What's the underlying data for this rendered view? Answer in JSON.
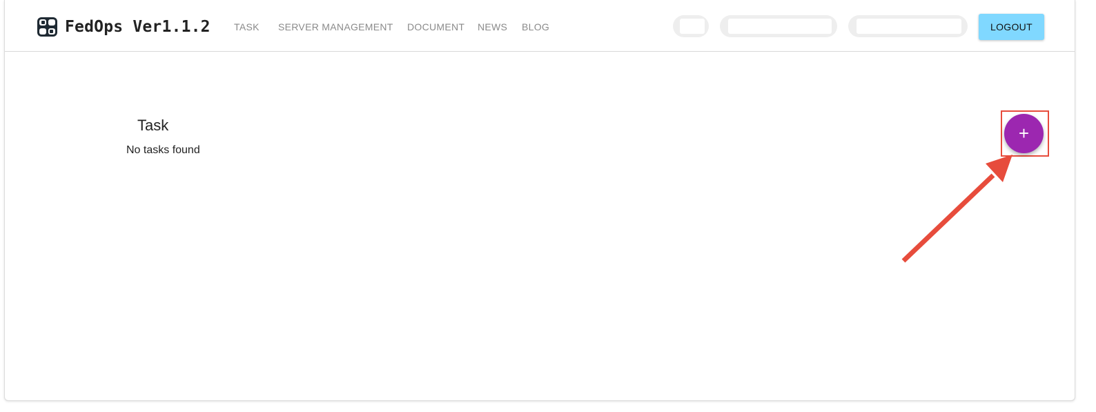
{
  "app": {
    "brand": "FedOps Ver1.1.2"
  },
  "nav": {
    "items": [
      {
        "label": "TASK"
      },
      {
        "label": "SERVER MANAGEMENT"
      },
      {
        "label": "DOCUMENT"
      },
      {
        "label": "NEWS"
      },
      {
        "label": "BLOG"
      }
    ]
  },
  "header": {
    "logout_label": "LOGOUT",
    "logout_color": "#80d8ff"
  },
  "main": {
    "title": "Task",
    "empty_message": "No tasks found",
    "fab_label": "+",
    "fab_color": "#9c27b0"
  },
  "annotation": {
    "color": "#e74c3c"
  }
}
